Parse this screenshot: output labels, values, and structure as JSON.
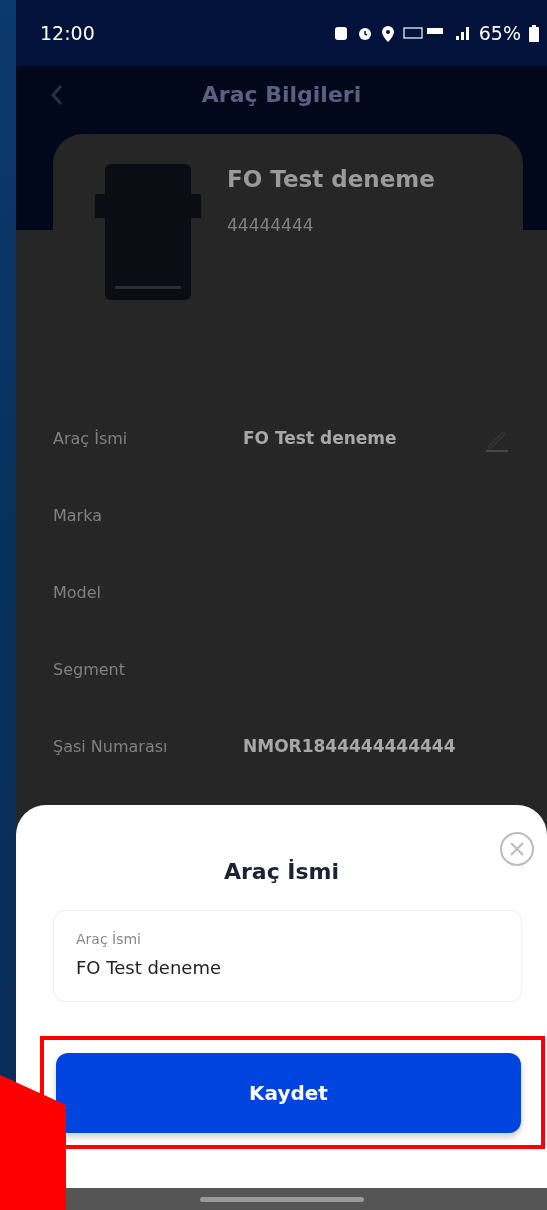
{
  "status_bar": {
    "time": "12:00",
    "battery": "65%"
  },
  "header": {
    "title": "Araç Bilgileri"
  },
  "vehicle": {
    "name": "FO Test deneme",
    "plate": "44444444"
  },
  "details": [
    {
      "label": "Araç İsmi",
      "value": "FO Test deneme",
      "editable": true
    },
    {
      "label": "Marka",
      "editable": false
    },
    {
      "label": "Model",
      "editable": false
    },
    {
      "label": "Segment",
      "editable": false
    },
    {
      "label": "Şasi Numarası",
      "value": "NMOR1844444444444",
      "editable": false
    }
  ],
  "sheet": {
    "title": "Araç İsmi",
    "field": {
      "label": "Araç İsmi",
      "value": "FO Test deneme"
    },
    "button": "Kaydet",
    "highlighted": true
  }
}
